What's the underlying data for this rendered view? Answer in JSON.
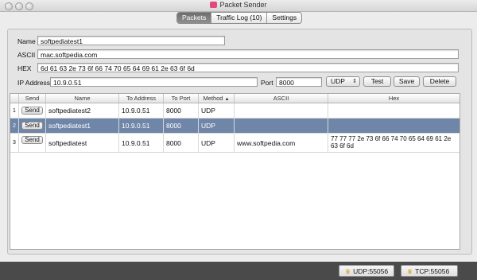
{
  "window": {
    "title": "Packet Sender"
  },
  "tabs": [
    {
      "label": "Packets",
      "active": true
    },
    {
      "label": "Traffic Log (10)",
      "active": false
    },
    {
      "label": "Settings",
      "active": false
    }
  ],
  "form": {
    "name_label": "Name",
    "name_value": "softpediatest1",
    "ascii_label": "ASCII",
    "ascii_value": "mac.softpedia.com",
    "hex_label": "HEX",
    "hex_value": "6d 61 63 2e 73 6f 66 74 70 65 64 69 61 2e 63 6f 6d",
    "ip_label": "IP Address",
    "ip_value": "10.9.0.51",
    "port_label": "Port",
    "port_value": "8000",
    "protocol_selected": "UDP",
    "test_label": "Test",
    "save_label": "Save",
    "delete_label": "Delete"
  },
  "table": {
    "headers": [
      "Send",
      "Name",
      "To Address",
      "To Port",
      "Method",
      "ASCII",
      "Hex"
    ],
    "sort_indicator": "▲",
    "rows": [
      {
        "num": "1",
        "send": "Send",
        "name": "softpediatest2",
        "address": "10.9.0.51",
        "port": "8000",
        "method": "UDP",
        "ascii": "",
        "hex": ""
      },
      {
        "num": "2",
        "send": "Send",
        "name": "softpediatest1",
        "address": "10.9.0.51",
        "port": "8000",
        "method": "UDP",
        "ascii": "",
        "hex": "",
        "selected": true
      },
      {
        "num": "3",
        "send": "Send",
        "name": "softpediatest",
        "address": "10.9.0.51",
        "port": "8000",
        "method": "UDP",
        "ascii": "www.softpedia.com",
        "hex": "77 77 77 2e 73 6f 66 74 70 65 64 69 61 2e 63 6f 6d"
      }
    ]
  },
  "status": {
    "udp": "UDP:55056",
    "tcp": "TCP:55056"
  },
  "colors": {
    "selection": "#6f86a8",
    "statusbar": "#4a4a4a",
    "active_tab": "#7a7a7a"
  }
}
